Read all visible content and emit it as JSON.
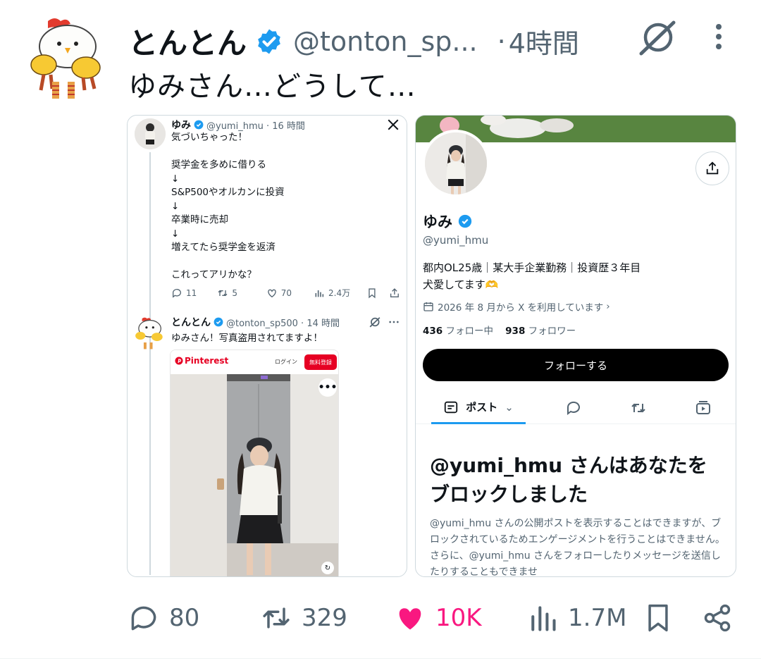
{
  "tweet": {
    "display_name": "とんとん",
    "handle": "@tonton_sp...",
    "separator": "·",
    "time": "4時間",
    "text": "ゆみさん…どうして…",
    "stats": {
      "replies": "80",
      "reposts": "329",
      "likes": "10K",
      "views": "1.7M"
    },
    "colors": {
      "verified": "#1d9bf0",
      "like": "#f91880",
      "muted": "#536471"
    }
  },
  "quoted_tweet_1": {
    "display_name": "ゆみ",
    "handle_time": "@yumi_hmu · 16 時間",
    "text": "気づいちゃった！\n\n奨学金を多めに借りる\n↓\nS&P500やオルカンに投資\n↓\n卒業時に売却\n↓\n増えてたら奨学金を返済\n\nこれってアリかな？",
    "replies": "11",
    "reposts": "5",
    "likes": "70",
    "views": "2.4万"
  },
  "quoted_tweet_2": {
    "display_name": "とんとん",
    "handle_time": "@tonton_sp500 · 14 時間",
    "text": "ゆみさん！写真盗用されてますよ！",
    "pinterest": {
      "brand": "Pinterest",
      "login": "ログイン",
      "signup": "無料登録",
      "more": "•••"
    }
  },
  "profile_card": {
    "name": "ゆみ",
    "handle": "@yumi_hmu",
    "bio": "都内OL25歳｜某大手企業勤務｜投資歴３年目\n犬愛してます🫶",
    "joined": "2026 年 8 月から X を利用しています",
    "following_count": "436",
    "following_label": "フォロー中",
    "followers_count": "938",
    "followers_label": "フォロワー",
    "follow_button": "フォローする",
    "tab_posts": "ポスト",
    "blocked_title": "@yumi_hmu さんはあなたをブロックしました",
    "blocked_body": "@yumi_hmu さんの公開ポストを表示することはできますが、ブロックされているためエンゲージメントを行うことはできません。さらに、@yumi_hmu さんをフォローしたりメッセージを送信したりすることもできませ"
  }
}
